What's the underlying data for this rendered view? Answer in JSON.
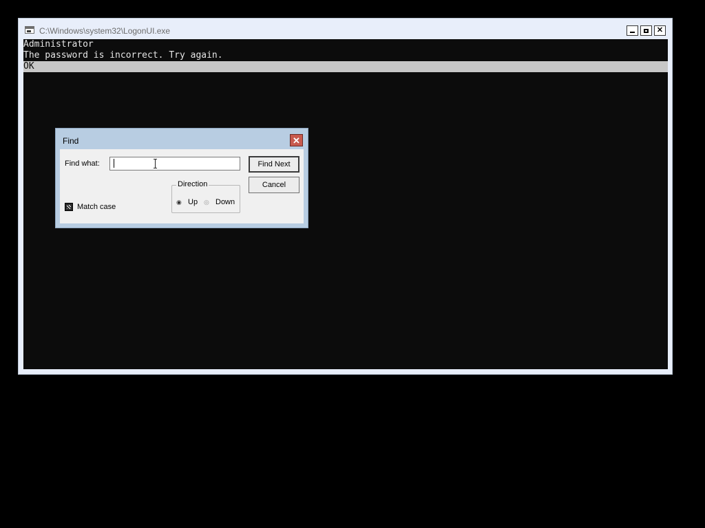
{
  "window": {
    "title": "C:\\Windows\\system32\\LogonUI.exe",
    "icon": "console-window-icon"
  },
  "console": {
    "lines": [
      "Administrator",
      "The password is incorrect. Try again.",
      "OK"
    ],
    "background": "#0c0c0c",
    "text_color": "#e5e5e5",
    "highlight_color": "#c7c7c7"
  },
  "find_dialog": {
    "title": "Find",
    "find_what_label": "Find what:",
    "find_what_value": "",
    "find_next_label": "Find Next",
    "cancel_label": "Cancel",
    "direction_label": "Direction",
    "up_label": "Up",
    "down_label": "Down",
    "match_case_label": "Match case",
    "selected_direction": "Down",
    "match_case_checked": false
  },
  "colors": {
    "dialog_title_bar": "#b8cde2",
    "close_button": "#c85a4e",
    "dialog_body": "#f0f0f0"
  }
}
